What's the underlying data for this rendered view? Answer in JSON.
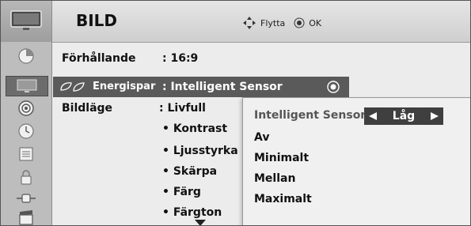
{
  "header": {
    "title": "BILD",
    "move_hint": "Flytta",
    "ok_hint": "OK"
  },
  "menu": {
    "aspect_label": "Förhållande",
    "aspect_value": ": 16:9",
    "energy_label": "Energispar",
    "energy_value": ": Intelligent Sensor",
    "picture_mode_label": "Bildläge",
    "picture_mode_value": ": Livfull",
    "items": [
      "• Kontrast",
      "• Ljusstyrka",
      "• Skärpa",
      "• Färg",
      "• Färgton"
    ]
  },
  "popup": {
    "title": "Intelligent Sensor",
    "level_value": "Låg",
    "options": [
      "Av",
      "Minimalt",
      "Mellan",
      "Maximalt"
    ]
  },
  "icons": [
    "tv-icon",
    "picture-settings-icon",
    "picture-icon",
    "audio-icon",
    "clock-icon",
    "option-icon",
    "lock-icon",
    "input-icon",
    "media-icon"
  ],
  "colors": {
    "highlight": "#5a5a5a",
    "popup_bg": "#f0f0f0",
    "level_box": "#3f3f3f"
  }
}
